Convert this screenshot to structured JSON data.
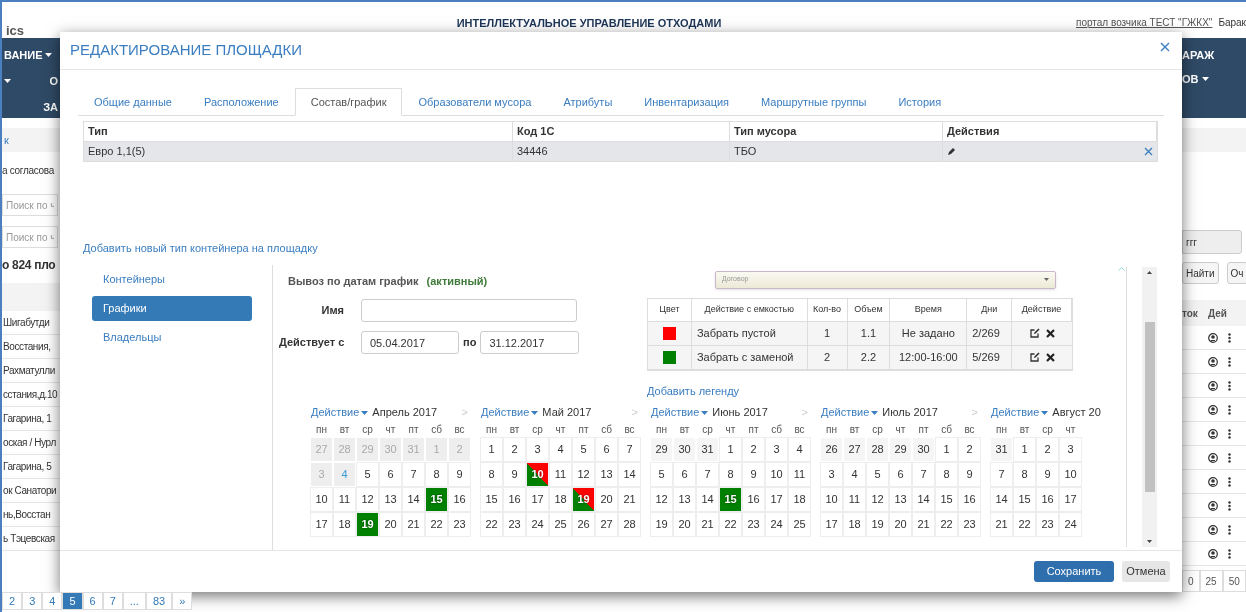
{
  "background": {
    "logo": "ics",
    "title": "ИНТЕЛЛЕКТУАЛЬНОЕ УПРАВЛЕНИЕ ОТХОДАМИ",
    "portal_link": "портал возчика ТЕСТ \"ГЖКХ\"",
    "user": "Барак",
    "nav_left": [
      {
        "label": "ВАНИЕ",
        "caret": true,
        "lead_caret": false
      },
      {
        "label": "О",
        "caret": false,
        "lead_caret": true
      },
      {
        "label": "ЗА",
        "caret": false,
        "lead_caret": false
      }
    ],
    "nav_right": [
      {
        "label": "АРАЖ",
        "caret": false
      },
      {
        "label": "ОВ",
        "caret": true
      }
    ],
    "breadcrumb": "к",
    "filter_label": "а согласова",
    "search_fields": [
      {
        "placeholder": "Поиск по ч"
      },
      {
        "placeholder": "Поиск по ч"
      }
    ],
    "search_value": "ггг",
    "buttons": [
      "Найти",
      "Оч"
    ],
    "count": "о 824 пло",
    "columns": [
      "ток",
      "Дей"
    ],
    "rows": [
      {
        "address": "Шигабутди"
      },
      {
        "address": "Восстания,"
      },
      {
        "address": "Рахматулли"
      },
      {
        "address": "сстания,д.10"
      },
      {
        "address": "Гагарина, 1"
      },
      {
        "address": "оская / Нурл"
      },
      {
        "address": "Гагарина, 5"
      },
      {
        "address": "ок Санатори"
      },
      {
        "address": "нь,Восстан"
      },
      {
        "address": "ь Тэцевская"
      }
    ],
    "pagination": [
      {
        "label": "2",
        "selected": false
      },
      {
        "label": "3",
        "selected": false
      },
      {
        "label": "4",
        "selected": false
      },
      {
        "label": "5",
        "selected": true
      },
      {
        "label": "6",
        "selected": false
      },
      {
        "label": "7",
        "selected": false
      },
      {
        "label": "...",
        "selected": false
      },
      {
        "label": "83",
        "selected": false
      },
      {
        "label": "»",
        "selected": false
      }
    ],
    "page_sizes": [
      "0",
      "25",
      "50"
    ]
  },
  "modal": {
    "title": "РЕДАКТИРОВАНИЕ ПЛОЩАДКИ",
    "tabs": [
      {
        "label": "Общие данные",
        "selected": false
      },
      {
        "label": "Расположение",
        "selected": false
      },
      {
        "label": "Состав/график",
        "selected": true
      },
      {
        "label": "Образователи мусора",
        "selected": false
      },
      {
        "label": "Атрибуты",
        "selected": false
      },
      {
        "label": "Инвентаризация",
        "selected": false
      },
      {
        "label": "Маршрутные группы",
        "selected": false
      },
      {
        "label": "История",
        "selected": false
      }
    ],
    "table": {
      "columns": [
        "Тип",
        "Код 1С",
        "Тип мусора",
        "Действия"
      ],
      "rows": [
        {
          "cells": [
            "Евро 1,1(5)",
            "34446",
            "ТБО"
          ],
          "selected": true
        }
      ]
    },
    "add_container_link": "Добавить новый тип контейнера на площадку",
    "side_nav": [
      {
        "label": "Контейнеры",
        "selected": false
      },
      {
        "label": "Графики",
        "selected": true
      },
      {
        "label": "Владельцы",
        "selected": false
      }
    ],
    "schedule": {
      "title": "Вывоз по датам график",
      "status": "(активный)",
      "name_label": "Имя",
      "valid_label": "Действует с",
      "from": "05.04.2017",
      "to_label": "по",
      "to": "31.12.2017",
      "dropdown": {
        "placeholder": "Договор"
      },
      "legend_columns": [
        "Цвет",
        "Действие с емкостью",
        "Кол-во",
        "Объем",
        "Время",
        "Дни",
        "Действие"
      ],
      "legend": [
        {
          "color": "#ff0000",
          "action": "Забрать пустой",
          "qty": "1",
          "volume": "1.1",
          "time": "Не задано",
          "days": "2/269"
        },
        {
          "color": "#008000",
          "action": "Забрать с заменой",
          "qty": "2",
          "volume": "2.2",
          "time": "12:00-16:00",
          "days": "5/269"
        }
      ],
      "add_legend": "Добавить легенду",
      "months": [
        {
          "action": "Действие",
          "title": "Апрель 2017",
          "next": ">",
          "weekdays": [
            "пн",
            "вт",
            "ср",
            "чт",
            "пт",
            "сб",
            "вс"
          ],
          "weeks": [
            [
              {
                "d": "27",
                "kind": "past"
              },
              {
                "d": "28",
                "kind": "past"
              },
              {
                "d": "29",
                "kind": "past"
              },
              {
                "d": "30",
                "kind": "past"
              },
              {
                "d": "31",
                "kind": "past"
              },
              {
                "d": "1",
                "kind": "past"
              },
              {
                "d": "2",
                "kind": "past"
              }
            ],
            [
              {
                "d": "3",
                "kind": "past"
              },
              {
                "d": "4",
                "kind": "today"
              },
              {
                "d": "5",
                "kind": "day"
              },
              {
                "d": "6",
                "kind": "day"
              },
              {
                "d": "7",
                "kind": "day"
              },
              {
                "d": "8",
                "kind": "day"
              },
              {
                "d": "9",
                "kind": "day"
              }
            ],
            [
              {
                "d": "10",
                "kind": "day"
              },
              {
                "d": "11",
                "kind": "day"
              },
              {
                "d": "12",
                "kind": "day"
              },
              {
                "d": "13",
                "kind": "day"
              },
              {
                "d": "14",
                "kind": "day"
              },
              {
                "d": "15",
                "kind": "day",
                "marks": [
                  {
                    "color": "#008000"
                  }
                ]
              },
              {
                "d": "16",
                "kind": "day"
              }
            ],
            [
              {
                "d": "17",
                "kind": "day"
              },
              {
                "d": "18",
                "kind": "day"
              },
              {
                "d": "19",
                "kind": "day",
                "marks": [
                  {
                    "color": "#008000"
                  }
                ]
              },
              {
                "d": "20",
                "kind": "day"
              },
              {
                "d": "21",
                "kind": "day"
              },
              {
                "d": "22",
                "kind": "day"
              },
              {
                "d": "23",
                "kind": "day"
              }
            ]
          ]
        },
        {
          "action": "Действие",
          "title": "Май 2017",
          "next": ">",
          "weekdays": [
            "пн",
            "вт",
            "ср",
            "чт",
            "пт",
            "сб",
            "вс"
          ],
          "weeks": [
            [
              {
                "d": "1",
                "kind": "day"
              },
              {
                "d": "2",
                "kind": "day"
              },
              {
                "d": "3",
                "kind": "day"
              },
              {
                "d": "4",
                "kind": "day"
              },
              {
                "d": "5",
                "kind": "day"
              },
              {
                "d": "6",
                "kind": "day"
              },
              {
                "d": "7",
                "kind": "day"
              }
            ],
            [
              {
                "d": "8",
                "kind": "day"
              },
              {
                "d": "9",
                "kind": "day"
              },
              {
                "d": "10",
                "kind": "day",
                "marks": [
                  {
                    "color": "#008000"
                  },
                  {
                    "color": "#ff0000"
                  }
                ]
              },
              {
                "d": "11",
                "kind": "day"
              },
              {
                "d": "12",
                "kind": "day"
              },
              {
                "d": "13",
                "kind": "day"
              },
              {
                "d": "14",
                "kind": "day"
              }
            ],
            [
              {
                "d": "15",
                "kind": "day"
              },
              {
                "d": "16",
                "kind": "day"
              },
              {
                "d": "17",
                "kind": "day"
              },
              {
                "d": "18",
                "kind": "day"
              },
              {
                "d": "19",
                "kind": "day",
                "marks": [
                  {
                    "color": "#008000"
                  },
                  {
                    "color": "#ff0000"
                  }
                ]
              },
              {
                "d": "20",
                "kind": "day"
              },
              {
                "d": "21",
                "kind": "day"
              }
            ],
            [
              {
                "d": "22",
                "kind": "day"
              },
              {
                "d": "23",
                "kind": "day"
              },
              {
                "d": "24",
                "kind": "day"
              },
              {
                "d": "25",
                "kind": "day"
              },
              {
                "d": "26",
                "kind": "day"
              },
              {
                "d": "27",
                "kind": "day"
              },
              {
                "d": "28",
                "kind": "day"
              }
            ]
          ]
        },
        {
          "action": "Действие",
          "title": "Июнь 2017",
          "next": ">",
          "weekdays": [
            "пн",
            "вт",
            "ср",
            "чт",
            "пт",
            "сб",
            "вс"
          ],
          "weeks": [
            [
              {
                "d": "29",
                "kind": "other"
              },
              {
                "d": "30",
                "kind": "other"
              },
              {
                "d": "31",
                "kind": "other"
              },
              {
                "d": "1",
                "kind": "day"
              },
              {
                "d": "2",
                "kind": "day"
              },
              {
                "d": "3",
                "kind": "day"
              },
              {
                "d": "4",
                "kind": "day"
              }
            ],
            [
              {
                "d": "5",
                "kind": "day"
              },
              {
                "d": "6",
                "kind": "day"
              },
              {
                "d": "7",
                "kind": "day"
              },
              {
                "d": "8",
                "kind": "day"
              },
              {
                "d": "9",
                "kind": "day"
              },
              {
                "d": "10",
                "kind": "day"
              },
              {
                "d": "11",
                "kind": "day"
              }
            ],
            [
              {
                "d": "12",
                "kind": "day"
              },
              {
                "d": "13",
                "kind": "day"
              },
              {
                "d": "14",
                "kind": "day"
              },
              {
                "d": "15",
                "kind": "day",
                "marks": [
                  {
                    "color": "#008000"
                  }
                ]
              },
              {
                "d": "16",
                "kind": "day"
              },
              {
                "d": "17",
                "kind": "day"
              },
              {
                "d": "18",
                "kind": "day"
              }
            ],
            [
              {
                "d": "19",
                "kind": "day"
              },
              {
                "d": "20",
                "kind": "day"
              },
              {
                "d": "21",
                "kind": "day"
              },
              {
                "d": "22",
                "kind": "day"
              },
              {
                "d": "23",
                "kind": "day"
              },
              {
                "d": "24",
                "kind": "day"
              },
              {
                "d": "25",
                "kind": "day"
              }
            ]
          ]
        },
        {
          "action": "Действие",
          "title": "Июль 2017",
          "next": ">",
          "weekdays": [
            "пн",
            "вт",
            "ср",
            "чт",
            "пт",
            "сб",
            "вс"
          ],
          "weeks": [
            [
              {
                "d": "26",
                "kind": "other"
              },
              {
                "d": "27",
                "kind": "other"
              },
              {
                "d": "28",
                "kind": "other"
              },
              {
                "d": "29",
                "kind": "other"
              },
              {
                "d": "30",
                "kind": "other"
              },
              {
                "d": "1",
                "kind": "day"
              },
              {
                "d": "2",
                "kind": "day"
              }
            ],
            [
              {
                "d": "3",
                "kind": "day"
              },
              {
                "d": "4",
                "kind": "day"
              },
              {
                "d": "5",
                "kind": "day"
              },
              {
                "d": "6",
                "kind": "day"
              },
              {
                "d": "7",
                "kind": "day"
              },
              {
                "d": "8",
                "kind": "day"
              },
              {
                "d": "9",
                "kind": "day"
              }
            ],
            [
              {
                "d": "10",
                "kind": "day"
              },
              {
                "d": "11",
                "kind": "day"
              },
              {
                "d": "12",
                "kind": "day"
              },
              {
                "d": "13",
                "kind": "day"
              },
              {
                "d": "14",
                "kind": "day"
              },
              {
                "d": "15",
                "kind": "day"
              },
              {
                "d": "16",
                "kind": "day"
              }
            ],
            [
              {
                "d": "17",
                "kind": "day"
              },
              {
                "d": "18",
                "kind": "day"
              },
              {
                "d": "19",
                "kind": "day"
              },
              {
                "d": "20",
                "kind": "day"
              },
              {
                "d": "21",
                "kind": "day"
              },
              {
                "d": "22",
                "kind": "day"
              },
              {
                "d": "23",
                "kind": "day"
              }
            ]
          ]
        },
        {
          "action": "Действие",
          "title": "Август 20",
          "weekdays": [
            "пн",
            "вт",
            "ср",
            "чт"
          ],
          "weeks": [
            [
              {
                "d": "31",
                "kind": "other"
              },
              {
                "d": "1",
                "kind": "day"
              },
              {
                "d": "2",
                "kind": "day"
              },
              {
                "d": "3",
                "kind": "day"
              }
            ],
            [
              {
                "d": "7",
                "kind": "day"
              },
              {
                "d": "8",
                "kind": "day"
              },
              {
                "d": "9",
                "kind": "day"
              },
              {
                "d": "10",
                "kind": "day"
              }
            ],
            [
              {
                "d": "14",
                "kind": "day"
              },
              {
                "d": "15",
                "kind": "day"
              },
              {
                "d": "16",
                "kind": "day"
              },
              {
                "d": "17",
                "kind": "day"
              }
            ],
            [
              {
                "d": "21",
                "kind": "day"
              },
              {
                "d": "22",
                "kind": "day"
              },
              {
                "d": "23",
                "kind": "day"
              },
              {
                "d": "24",
                "kind": "day"
              }
            ]
          ]
        }
      ]
    },
    "buttons": [
      {
        "label": "Сохранить",
        "kind": "primary"
      },
      {
        "label": "Отмена",
        "kind": "secondary"
      }
    ]
  }
}
